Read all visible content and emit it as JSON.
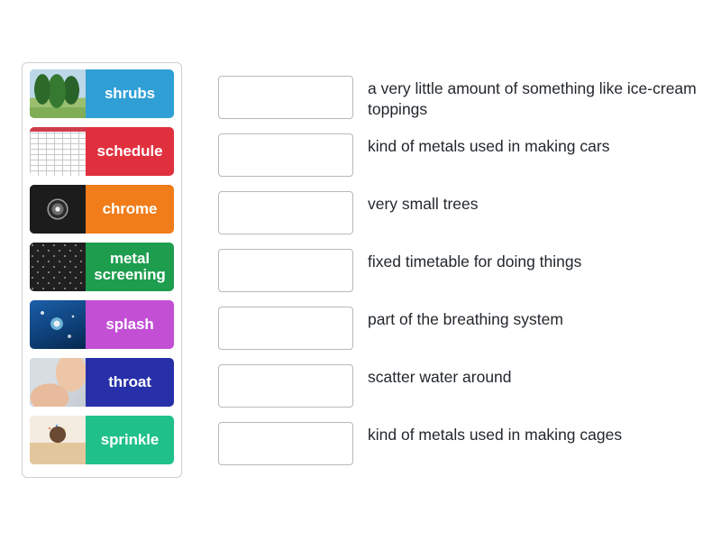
{
  "activity": {
    "type": "match-up",
    "tiles": [
      {
        "label": "shrubs",
        "thumb": "shrubs-image",
        "color": "#2f9fd6",
        "thumb_class": "thumb-shrubs"
      },
      {
        "label": "schedule",
        "thumb": "schedule-image",
        "color": "#e0303e",
        "thumb_class": "thumb-schedule"
      },
      {
        "label": "chrome",
        "thumb": "chrome-image",
        "color": "#f07c1a",
        "thumb_class": "thumb-chrome"
      },
      {
        "label": "metal screening",
        "thumb": "metal-image",
        "color": "#1e9d4f",
        "thumb_class": "thumb-metal"
      },
      {
        "label": "splash",
        "thumb": "splash-image",
        "color": "#c24fd4",
        "thumb_class": "thumb-splash"
      },
      {
        "label": "throat",
        "thumb": "throat-image",
        "color": "#2730a8",
        "thumb_class": "thumb-throat"
      },
      {
        "label": "sprinkle",
        "thumb": "sprinkle-image",
        "color": "#1fc08a",
        "thumb_class": "thumb-sprinkle"
      }
    ],
    "answers": [
      {
        "definition": "a very little amount of something like ice-cream toppings",
        "dropped": ""
      },
      {
        "definition": "kind of metals used in making cars",
        "dropped": ""
      },
      {
        "definition": "very small trees",
        "dropped": ""
      },
      {
        "definition": "fixed timetable for doing things",
        "dropped": ""
      },
      {
        "definition": "part of the breathing system",
        "dropped": ""
      },
      {
        "definition": "scatter water around",
        "dropped": ""
      },
      {
        "definition": "kind of metals used in making cages",
        "dropped": ""
      }
    ]
  }
}
